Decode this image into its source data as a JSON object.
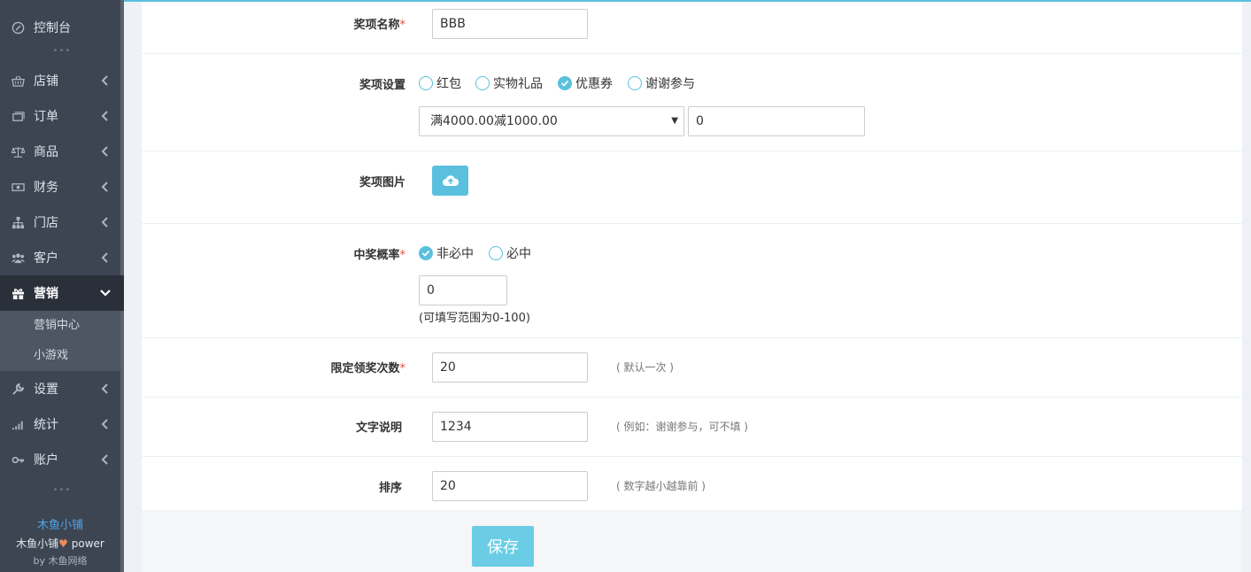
{
  "sidebar": {
    "items": [
      {
        "label": "控制台",
        "icon": "dashboard-icon"
      },
      {
        "label": "店铺",
        "icon": "shop-icon"
      },
      {
        "label": "订单",
        "icon": "order-icon"
      },
      {
        "label": "商品",
        "icon": "scale-icon"
      },
      {
        "label": "财务",
        "icon": "money-icon"
      },
      {
        "label": "门店",
        "icon": "sitemap-icon"
      },
      {
        "label": "客户",
        "icon": "users-icon"
      },
      {
        "label": "营销",
        "icon": "gift-icon"
      },
      {
        "label": "设置",
        "icon": "wrench-icon"
      },
      {
        "label": "统计",
        "icon": "signal-icon"
      },
      {
        "label": "账户",
        "icon": "key-icon"
      }
    ],
    "submenu": [
      "营销中心",
      "小游戏"
    ],
    "footer": {
      "brand": "木鱼小铺",
      "power_prefix": "木鱼小铺",
      "power_suffix": " power",
      "by": "by 木鱼网络"
    }
  },
  "form": {
    "prize_name": {
      "label": "奖项名称",
      "value": "BBB"
    },
    "prize_setting": {
      "label": "奖项设置",
      "options": [
        "红包",
        "实物礼品",
        "优惠券",
        "谢谢参与"
      ],
      "selected": "优惠券",
      "coupon": "满4000.00减1000.00",
      "quantity": "0"
    },
    "prize_image": {
      "label": "奖项图片"
    },
    "probability": {
      "label": "中奖概率",
      "options": [
        "非必中",
        "必中"
      ],
      "selected": "非必中",
      "value": "0",
      "hint": "(可填写范围为0-100)"
    },
    "limit": {
      "label": "限定领奖次数",
      "value": "20",
      "hint": "( 默认一次 )"
    },
    "text_desc": {
      "label": "文字说明",
      "value": "1234",
      "hint": "( 例如：谢谢参与，可不填 )"
    },
    "sort": {
      "label": "排序",
      "value": "20",
      "hint": "( 数字越小越靠前 )"
    },
    "save_label": "保存"
  },
  "colors": {
    "accent": "#5bc0de",
    "sidebar_bg": "#3d4553",
    "required": "#e74c3c"
  }
}
